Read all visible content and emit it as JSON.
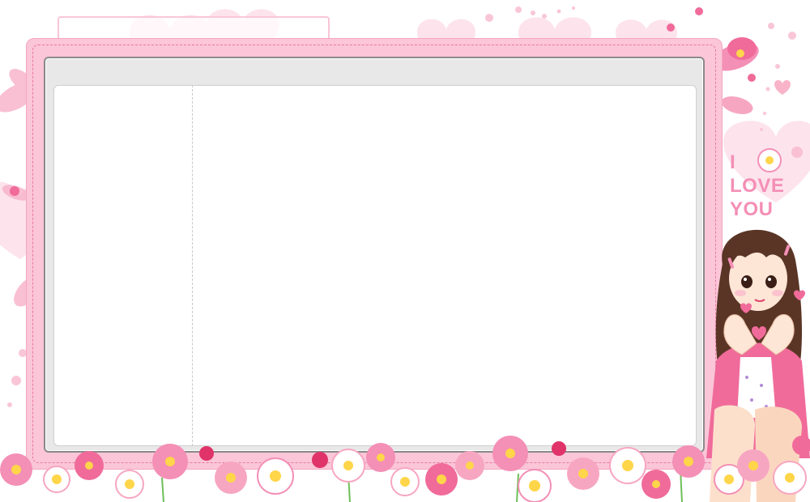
{
  "decoration": {
    "love_text": [
      "I",
      "LOVE",
      "YOU"
    ]
  },
  "colors": {
    "frame_pink": "#fbc6d7",
    "frame_dash": "#e87aa0",
    "panel_gray": "#e8e8e8",
    "panel_border": "#8a8a8a",
    "accent_pink": "#f48fb6"
  },
  "icons": [
    "heart-icon",
    "flower-icon",
    "girl-illustration"
  ]
}
